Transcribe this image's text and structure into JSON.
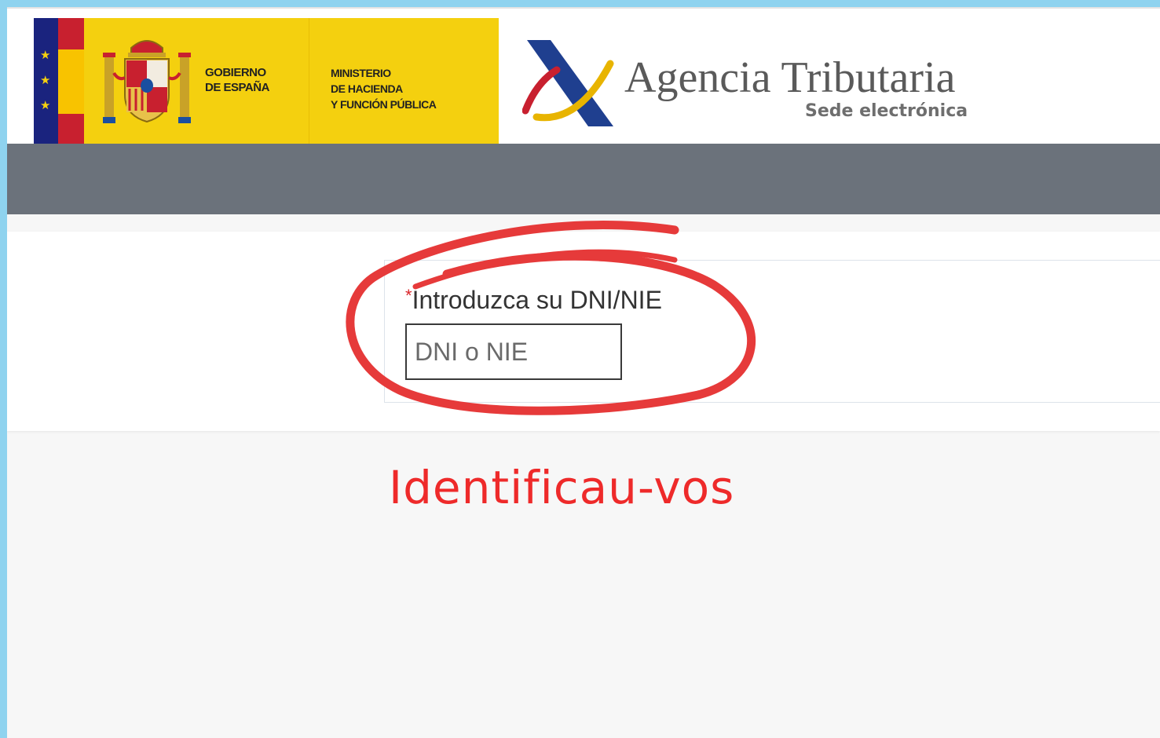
{
  "header": {
    "gov_text": "GOBIERNO\nDE ESPAÑA",
    "ministry_text": "MINISTERIO\nDE HACIENDA\nY FUNCIÓN PÚBLICA",
    "agency_name": "Agencia Tributaria",
    "agency_subtitle": "Sede electrónica",
    "eu_flag_icon": "eu-stars-icon",
    "coat_of_arms_icon": "spain-coat-of-arms-icon",
    "agency_logo_icon": "aeat-logo-icon"
  },
  "form": {
    "required_mark": "*",
    "dni_label": "Introduzca su DNI/NIE",
    "dni_placeholder": "DNI o NIE",
    "dni_value": ""
  },
  "annotation": {
    "caption": "Identificau-vos",
    "highlight_color": "#e63a3a"
  },
  "colors": {
    "background_border": "#8fd3ef",
    "navbar": "#6b727b",
    "gov_yellow": "#f4d00f",
    "caption_red": "#ee2a2a"
  }
}
